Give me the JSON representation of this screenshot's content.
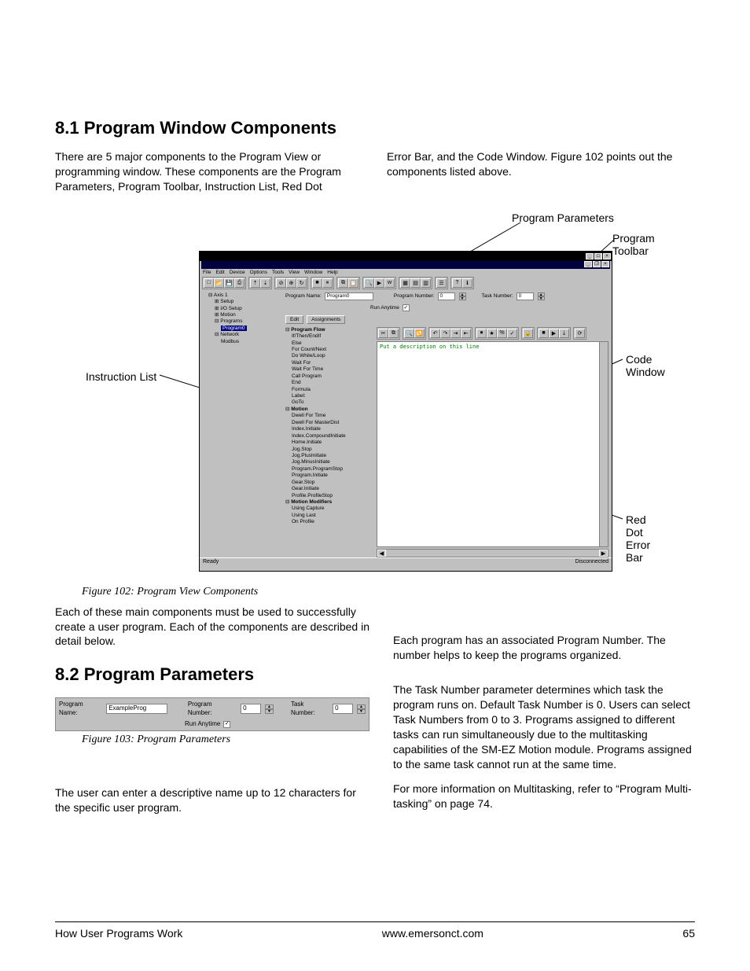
{
  "section1": {
    "heading": "8.1  Program Window Components",
    "para_left": "There are 5 major components to the Program View or programming window. These components are the Program Parameters, Program Toolbar, Instruction List, Red Dot",
    "para_right": "Error Bar, and the Code Window. Figure 102 points out the components listed above."
  },
  "fig102": {
    "caption": "Figure 102:     Program View Components",
    "callouts": {
      "instruction_list": "Instruction List",
      "program_parameters": "Program Parameters",
      "program_toolbar": "Program Toolbar",
      "code_window": "Code Window",
      "red_dot_error_bar": "Red Dot Error Bar"
    },
    "menu": [
      "File",
      "Edit",
      "Device",
      "Options",
      "Tools",
      "View",
      "Window",
      "Help"
    ],
    "tree": {
      "n0": "Axis 1",
      "n1": "Setup",
      "n2": "I/O Setup",
      "n3": "Motion",
      "n4": "Programs",
      "n5": "Program0",
      "n6": "Network",
      "n7": "Modbus"
    },
    "params": {
      "name_label": "Program Name:",
      "name_value": "Program0",
      "number_label": "Program Number:",
      "number_value": "0",
      "task_label": "Task Number:",
      "task_value": "0",
      "run_label": "Run Anytime",
      "edit_btn": "Edit",
      "assign_btn": "Assignments"
    },
    "instr": {
      "program_flow": "Program Flow",
      "pf": [
        "If/Then/EndIf",
        "Else",
        "For Count/Next",
        "Do While/Loop",
        "Wait For",
        "Wait For Time",
        "Call Program",
        "End",
        "Formula",
        "Label:",
        "GoTo"
      ],
      "motion": "Motion",
      "mo": [
        "Dwell For Time",
        "Dwell For MasterDist",
        "Index.Initiate",
        "Index.CompoundInitiate",
        "Home.Initiate",
        "Jog.Stop",
        "Jog.PlusInitiate",
        "Jog.MinusInitiate",
        "Program.ProgramStop",
        "Program.Initiate",
        "Gear.Stop",
        "Gear.Initiate",
        "Profile.ProfileStop"
      ],
      "mm": "Motion Modifiers",
      "mmi": [
        "Using Capture",
        "Using Last",
        "On Profile"
      ]
    },
    "code_comment": "Put a description on this line",
    "status_left": "Ready",
    "status_right": "Disconnected"
  },
  "after_fig102": "Each of these main components must be used to successfully create a user program. Each of the components are described in detail below.",
  "section2": {
    "heading": "8.2  Program Parameters",
    "fig_caption": "Figure 103:     Program Parameters",
    "params": {
      "name_label": "Program Name:",
      "name_value": "ExampleProg",
      "number_label": "Program Number:",
      "number_value": "0",
      "task_label": "Task Number:",
      "task_value": "0",
      "run_label": "Run Anytime"
    },
    "para_name": "The user can enter a descriptive name up to 12 characters for the specific user program.",
    "para_number": "Each program has an associated Program Number. The number helps to keep the programs organized.",
    "para_task": "The Task Number parameter determines which task the program runs on. Default Task Number is 0. Users can select Task Numbers from 0 to 3. Programs assigned to different tasks can run simultaneously due to the multitasking capabilities of the SM-EZ Motion module. Programs assigned to the same task cannot run at the same time.",
    "para_more": "For more information on Multitasking, refer to “Program Multi-tasking” on page 74."
  },
  "footer": {
    "left": "How User Programs Work",
    "center": "www.emersonct.com",
    "right": "65"
  }
}
